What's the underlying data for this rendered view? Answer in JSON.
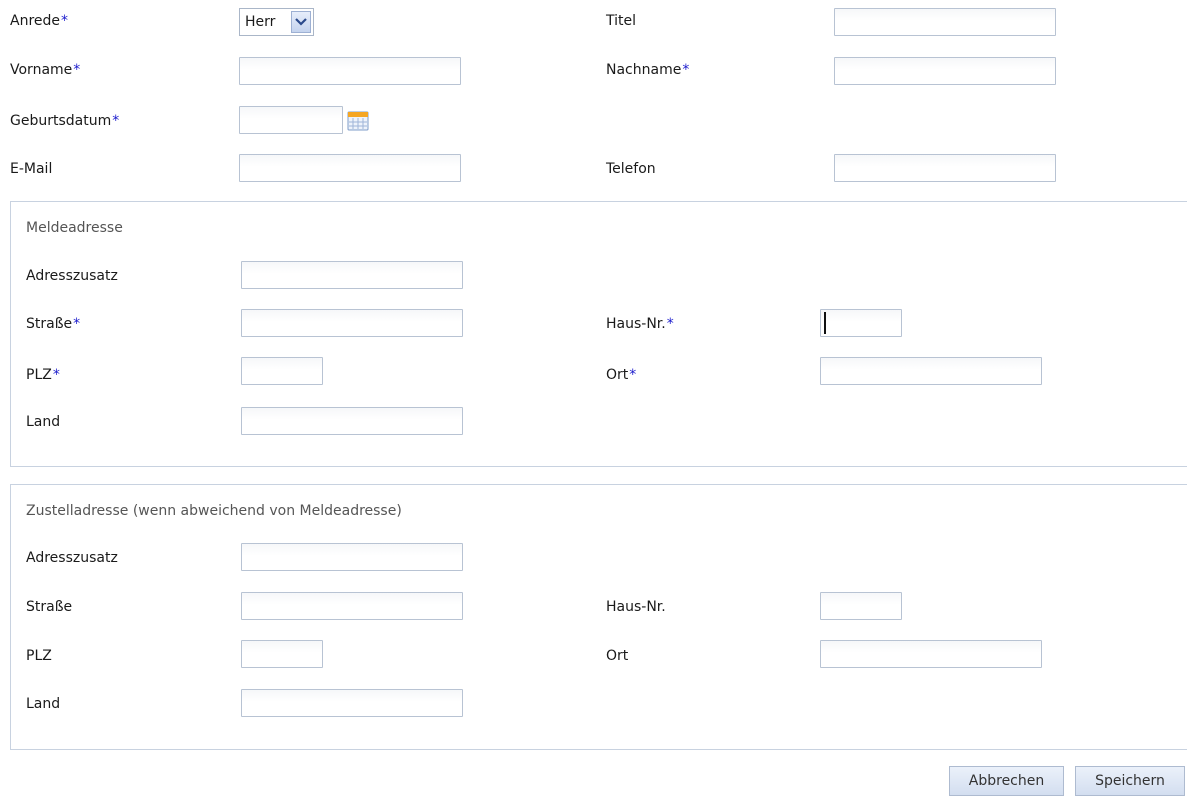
{
  "personal": {
    "anrede_label": "Anrede",
    "anrede_value": "Herr",
    "titel_label": "Titel",
    "vorname_label": "Vorname",
    "nachname_label": "Nachname",
    "geburtsdatum_label": "Geburtsdatum",
    "email_label": "E-Mail",
    "telefon_label": "Telefon",
    "required_mark": "*"
  },
  "melde": {
    "legend": "Meldeadresse",
    "adresszusatz_label": "Adresszusatz",
    "strasse_label": "Straße",
    "hausnr_label": "Haus-Nr.",
    "plz_label": "PLZ",
    "ort_label": "Ort",
    "land_label": "Land"
  },
  "zustell": {
    "legend": "Zustelladresse (wenn abweichend von Meldeadresse)",
    "adresszusatz_label": "Adresszusatz",
    "strasse_label": "Straße",
    "hausnr_label": "Haus-Nr.",
    "plz_label": "PLZ",
    "ort_label": "Ort",
    "land_label": "Land"
  },
  "actions": {
    "cancel_label": "Abbrechen",
    "save_label": "Speichern"
  },
  "colors": {
    "required": "#1a1acc",
    "input_border": "#b8c3d3",
    "button_bg": "#d3def0"
  },
  "icons": {
    "date_picker": "calendar-icon",
    "select_toggle": "chevron-down-icon"
  }
}
